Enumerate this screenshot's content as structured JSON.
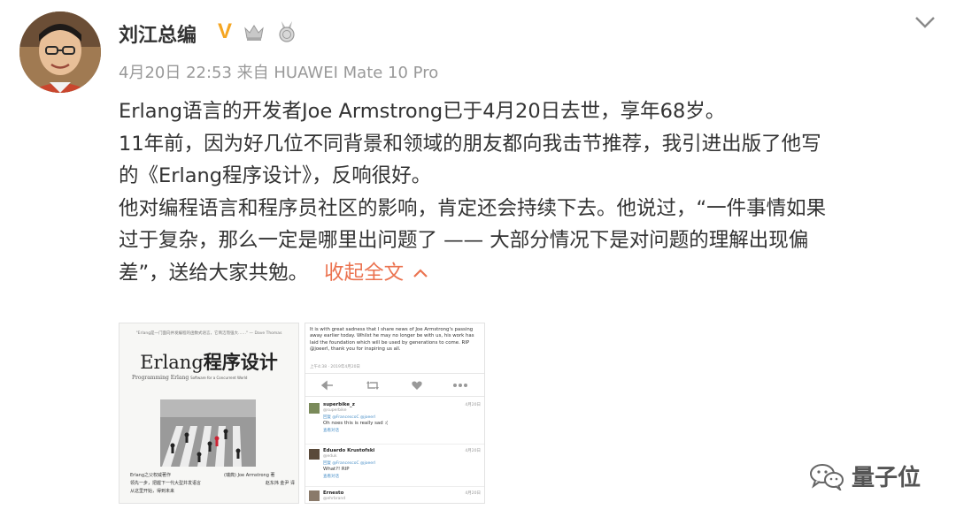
{
  "post": {
    "author": "刘江总编",
    "verified_badge": "V",
    "meta": "4月20日 22:53 来自 HUAWEI Mate 10 Pro",
    "lines": [
      "Erlang语言的开发者Joe Armstrong已于4月20日去世，享年68岁。",
      "11年前，因为好几位不同背景和领域的朋友都向我击节推荐，我引进出版了他写",
      "的《Erlang程序设计》，反响很好。",
      "他对编程语言和程序员社区的影响，肯定还会持续下去。他说过，“一件事情如果",
      "过于复杂，那么一定是哪里出问题了 —— 大部分情况下是对问题的理解出现偏",
      "差”，送给大家共勉。"
    ],
    "collapse_label": "收起全文"
  },
  "book": {
    "quote": "\"Erlang是一门面向并发编程的函数式语言，它简洁而强大……\" — Dave Thomas",
    "title_latin": "Erlang",
    "title_cn": "程序设计",
    "subtitle": "Programming Erlang",
    "subtitle_small": "Software for a Concurrent World",
    "bullets": [
      "Erlang之父权威著作",
      "领先一步，把握下一代大型并发语言",
      "从这里开始，得到未来"
    ],
    "authors": "(瑞典) Joe Armstrong 著",
    "translators": "赵东炜 金尹 译"
  },
  "tweet": {
    "text": "It is with great sadness that I share news of Joe Armstrong's passing away earlier today. Whilst he may no longer be with us, his work has laid the foundation which will be used by generations to come. RIP @joeerl, thank you for inspiring us all.",
    "time": "上午4:38 · 2019年4月20日",
    "replies": [
      {
        "user": "superbike_z",
        "handle": "@superbike",
        "time": "4月20日",
        "replying": "回复 @FrancescoC @joeerl",
        "text": "Oh noes this is really sad :(",
        "action": "查看对话"
      },
      {
        "user": "Eduardo Krustofski",
        "handle": "@eduk",
        "time": "4月20日",
        "replying": "回复 @FrancescoC @joeerl",
        "text": "What?! RIP",
        "action": "查看对话"
      },
      {
        "user": "Ernesto",
        "handle": "@ehrbrand",
        "time": "4月20日",
        "replying": "",
        "text": "",
        "action": ""
      }
    ]
  },
  "watermark": {
    "text": "量子位"
  },
  "colors": {
    "link": "#eb7350",
    "badge": "#f5a623",
    "meta": "#999999",
    "text": "#333333"
  },
  "icons": [
    "crown-icon",
    "medal-icon",
    "chevron-down-icon",
    "chevron-up-icon",
    "retweet-icon",
    "heart-icon",
    "reply-icon",
    "more-icon",
    "wechat-icon"
  ]
}
